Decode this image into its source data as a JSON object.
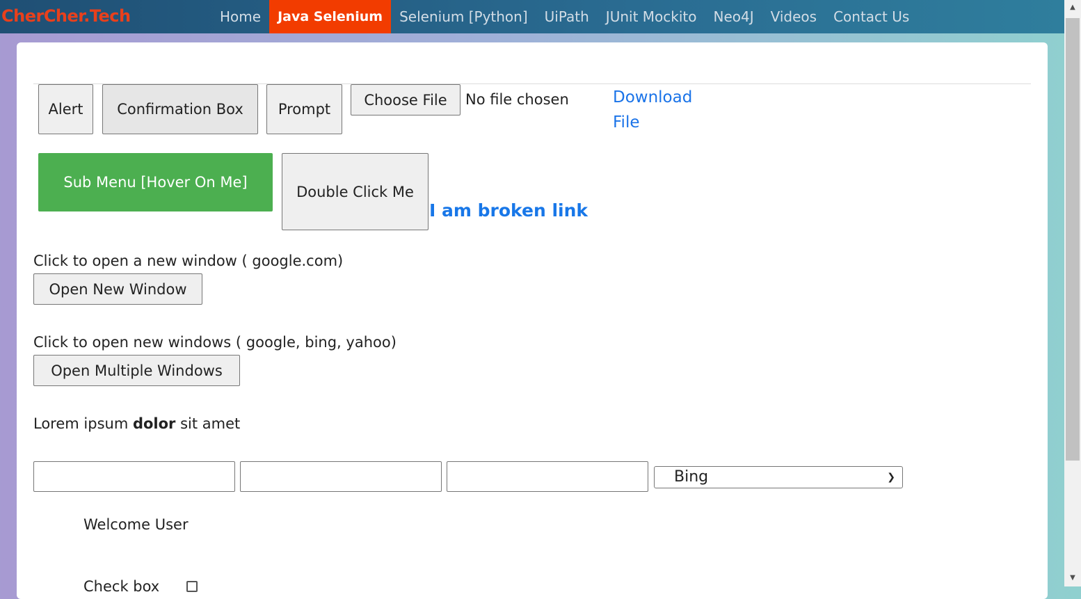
{
  "brand": "CherCher.Tech",
  "nav": {
    "items": [
      {
        "label": "Home",
        "active": false
      },
      {
        "label": "Java Selenium",
        "active": true
      },
      {
        "label": "Selenium [Python]",
        "active": false
      },
      {
        "label": "UiPath",
        "active": false
      },
      {
        "label": "JUnit Mockito",
        "active": false
      },
      {
        "label": "Neo4J",
        "active": false
      },
      {
        "label": "Videos",
        "active": false
      },
      {
        "label": "Contact Us",
        "active": false
      }
    ]
  },
  "buttons": {
    "alert": "Alert",
    "confirmation": "Confirmation Box",
    "prompt": "Prompt",
    "choose_file": "Choose File",
    "sub_menu": "Sub Menu [Hover On Me]",
    "double_click": "Double Click Me",
    "open_new_window": "Open New Window",
    "open_multiple_windows": "Open Multiple Windows"
  },
  "file_status": "No file chosen",
  "download_link": {
    "line1": "Download",
    "line2": "File"
  },
  "broken_link": "I am broken link",
  "labels": {
    "new_window": "Click to open a new window ( google.com)",
    "multi_window": "Click to open new windows ( google, bing, yahoo)",
    "lorem_start": "Lorem ipsum ",
    "lorem_bold": "dolor",
    "lorem_end": " sit amet",
    "welcome": "Welcome User",
    "checkbox": "Check box"
  },
  "select": {
    "selected": "Bing"
  },
  "colors": {
    "accent": "#f23c00",
    "brand": "#e8401c",
    "green": "#4caf50",
    "link": "#1a73e8"
  }
}
